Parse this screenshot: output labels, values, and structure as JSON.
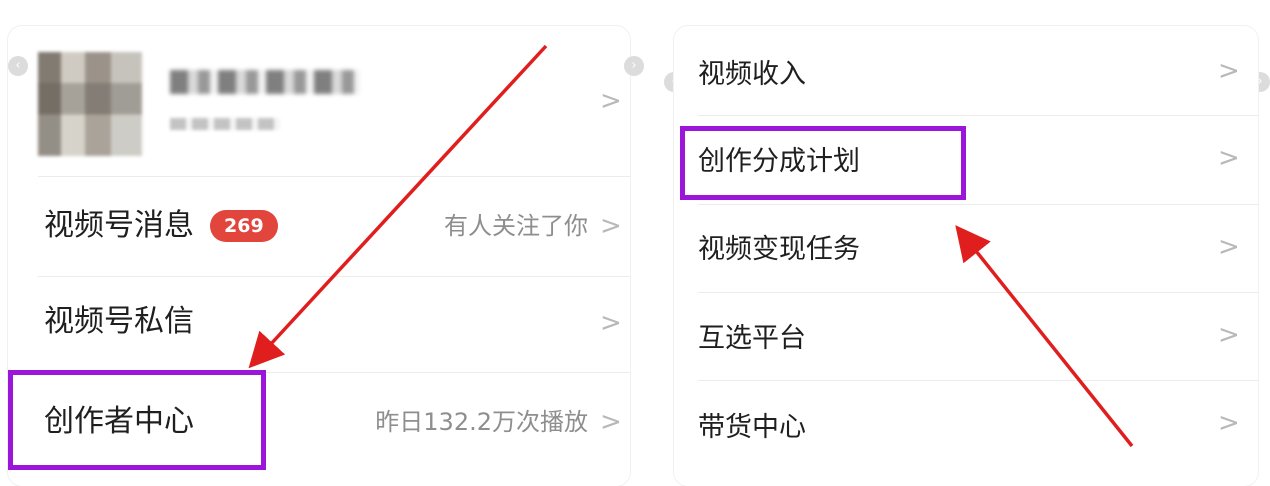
{
  "left": {
    "rows": [
      {
        "label": "视频号消息",
        "badge": "269",
        "sub": "有人关注了你"
      },
      {
        "label": "视频号私信",
        "sub": ""
      },
      {
        "label": "创作者中心",
        "sub": "昨日132.2万次播放"
      }
    ]
  },
  "right": {
    "rows": [
      {
        "label": "视频收入"
      },
      {
        "label": "创作分成计划"
      },
      {
        "label": "视频变现任务"
      },
      {
        "label": "互选平台"
      },
      {
        "label": "带货中心"
      }
    ]
  },
  "chevron_glyph": ">",
  "colors": {
    "highlight": "#9b16d8",
    "arrow": "#e01e1e",
    "badge": "#e2453c"
  }
}
